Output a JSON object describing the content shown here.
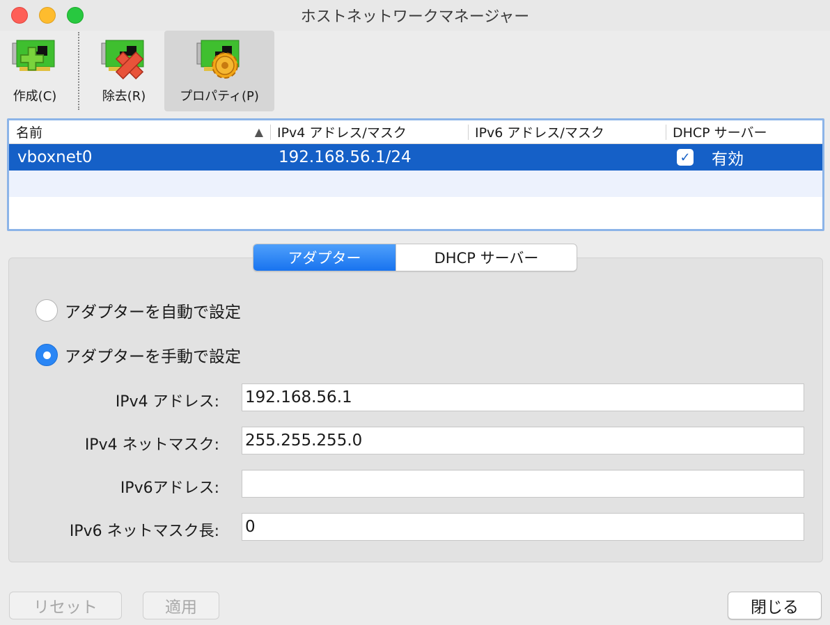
{
  "window": {
    "title": "ホストネットワークマネージャー"
  },
  "toolbar": {
    "create": {
      "label": "作成(C)"
    },
    "remove": {
      "label": "除去(R)"
    },
    "properties": {
      "label": "プロパティ(P)"
    }
  },
  "table": {
    "headers": [
      "名前",
      "IPv4 アドレス/マスク",
      "IPv6 アドレス/マスク",
      "DHCP サーバー"
    ],
    "sort_indicator": "▲",
    "rows": [
      {
        "name": "vboxnet0",
        "ipv4": "192.168.56.1/24",
        "ipv6": "",
        "dhcp_checked": true,
        "dhcp_label": "有効"
      }
    ]
  },
  "tabs": {
    "adapter": "アダプター",
    "dhcp": "DHCP サーバー",
    "active": "adapter"
  },
  "adapter": {
    "auto_label": "アダプターを自動で設定",
    "manual_label": "アダプターを手動で設定",
    "selected": "manual",
    "ipv4_address_label": "IPv4 アドレス:",
    "ipv4_address": "192.168.56.1",
    "ipv4_mask_label": "IPv4 ネットマスク:",
    "ipv4_mask": "255.255.255.0",
    "ipv6_address_label": "IPv6アドレス:",
    "ipv6_address": "",
    "ipv6_prefix_label": "IPv6 ネットマスク長:",
    "ipv6_prefix": "0"
  },
  "buttons": {
    "reset": "リセット",
    "apply": "適用",
    "close": "閉じる"
  },
  "colors": {
    "selection": "#1560c7",
    "accent": "#2a86f5",
    "focus_ring": "#8cb4e8"
  },
  "icons": {
    "create": "network-card-add-icon",
    "remove": "network-card-remove-icon",
    "properties": "network-card-properties-icon"
  }
}
